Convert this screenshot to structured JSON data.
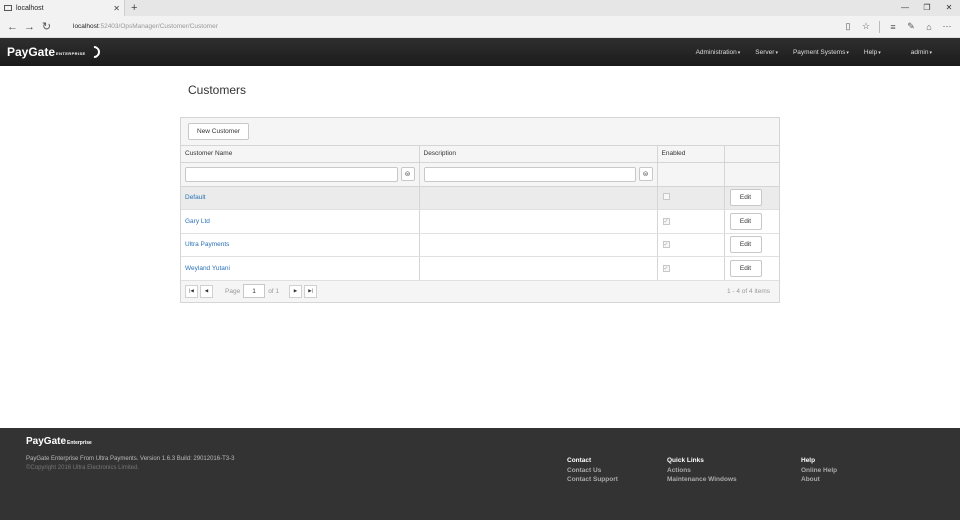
{
  "browser": {
    "tab_title": "localhost",
    "url_host": "localhost",
    "url_path": ":52403/OpsManager/Customer/Customer"
  },
  "navbar": {
    "brand": "PayGate",
    "brand_edition": "ENTERPRISE",
    "menu": {
      "administration": "Administration",
      "server": "Server",
      "payment_systems": "Payment Systems",
      "help": "Help",
      "user": "admin"
    }
  },
  "page": {
    "title": "Customers"
  },
  "grid": {
    "new_button": "New Customer",
    "columns": {
      "name": "Customer Name",
      "description": "Description",
      "enabled": "Enabled"
    },
    "edit_label": "Edit",
    "rows": [
      {
        "name": "Default",
        "description": "",
        "enabled": false
      },
      {
        "name": "Gary Ltd",
        "description": "",
        "enabled": true
      },
      {
        "name": "Ultra Payments",
        "description": "",
        "enabled": true
      },
      {
        "name": "Weyland Yutani",
        "description": "",
        "enabled": true
      }
    ],
    "pager": {
      "page_label": "Page",
      "page_value": "1",
      "of_label": "of 1",
      "info": "1 - 4 of 4 items"
    }
  },
  "footer": {
    "brand": "PayGate",
    "brand_edition": "Enterprise",
    "version": "PayGate Enterprise From Ultra Payments. Version 1.6.3 Build: 29012016-T3-3",
    "copyright": "©Copyright 2016 Ultra Electronics Limited.",
    "contact": {
      "heading": "Contact",
      "links": [
        "Contact Us",
        "Contact Support"
      ]
    },
    "quick_links": {
      "heading": "Quick Links",
      "links": [
        "Actions",
        "Maintenance Windows"
      ]
    },
    "help": {
      "heading": "Help",
      "links": [
        "Online Help",
        "About"
      ]
    }
  }
}
